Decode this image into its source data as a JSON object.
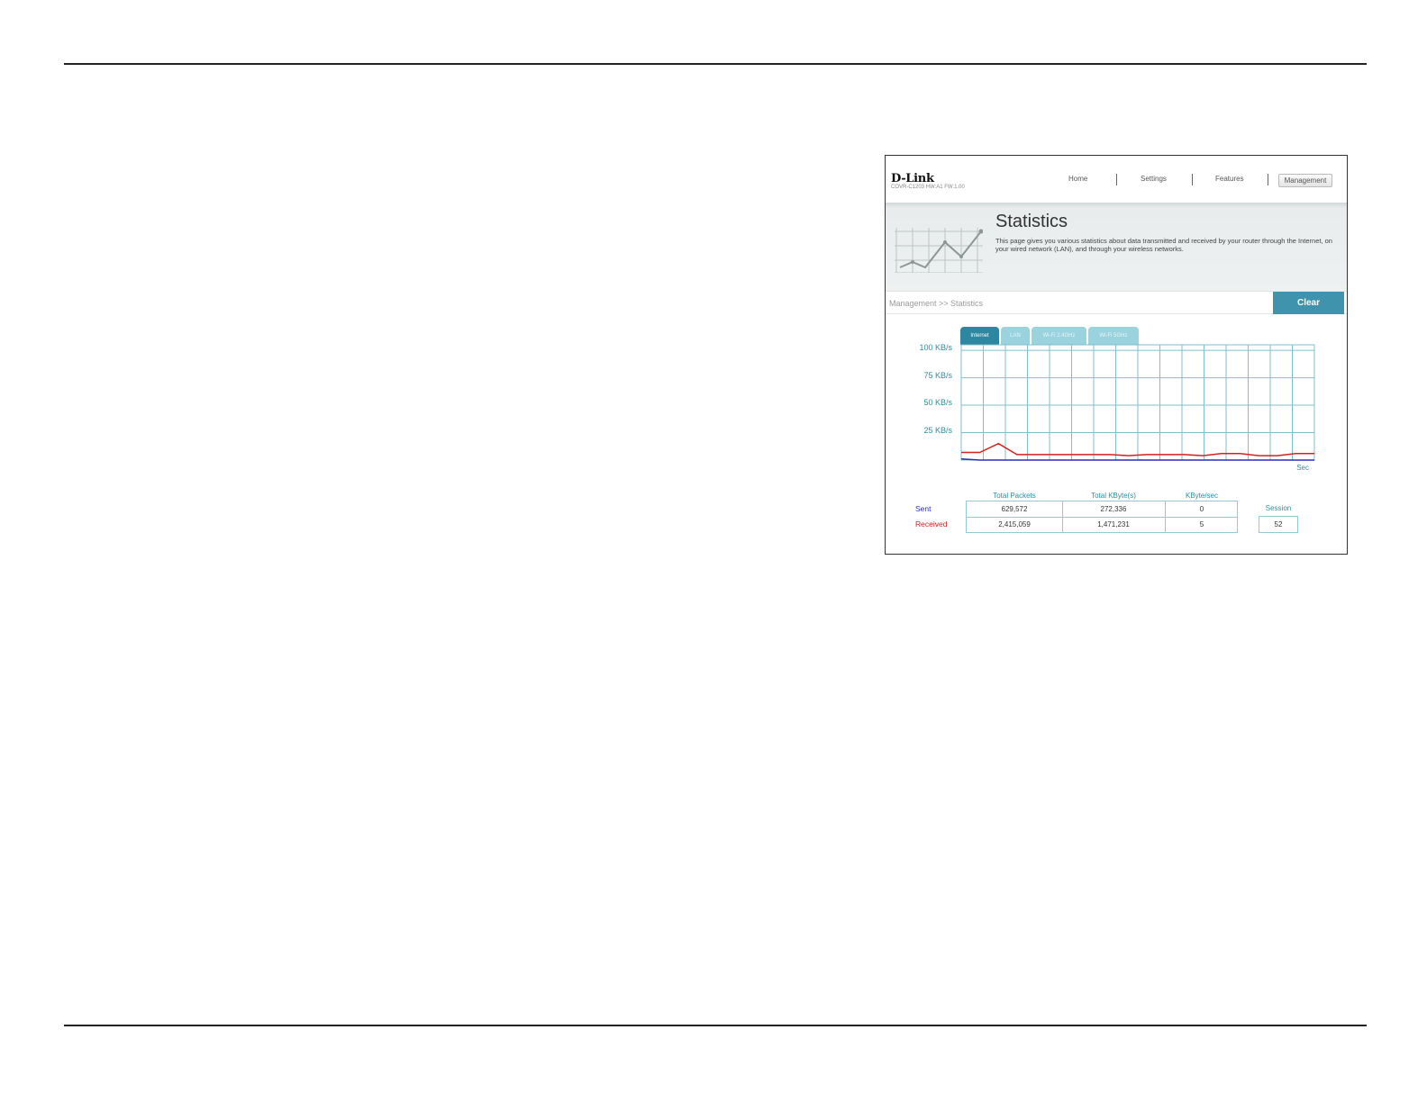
{
  "header": {
    "logo": "D-Link",
    "firmware": "COVR-C1203 HW:A1 FW:1.00",
    "nav": [
      "Home",
      "Settings",
      "Features",
      "Management"
    ],
    "active_nav": "Management"
  },
  "banner": {
    "title": "Statistics",
    "description": "This page gives you various statistics about data transmitted and received by your router through the Internet, on your wired network (LAN), and through your wireless networks."
  },
  "breadcrumb": "Management >> Statistics",
  "clear_label": "Clear",
  "tabs": [
    "Internet",
    "LAN",
    "Wi-Fi 2.4GHz",
    "Wi-Fi 5GHz"
  ],
  "active_tab": "Internet",
  "chart_data": {
    "type": "line",
    "y_ticks": [
      "100 KB/s",
      "75 KB/s",
      "50 KB/s",
      "25 KB/s"
    ],
    "ylim": [
      0,
      105
    ],
    "xlabel": "Sec",
    "grid": true,
    "series": [
      {
        "name": "Received",
        "color": "#d42020",
        "values": [
          7,
          7,
          15,
          5,
          5,
          5,
          5,
          5,
          5,
          4,
          5,
          5,
          5,
          4,
          6,
          6,
          4,
          4,
          6,
          6
        ]
      },
      {
        "name": "Sent",
        "color": "#2b2bbd",
        "values": [
          1,
          0,
          0,
          0,
          0,
          0,
          0,
          0,
          0,
          0,
          0,
          0,
          0,
          0,
          0,
          0,
          0,
          0,
          0,
          0
        ]
      }
    ]
  },
  "stats": {
    "headers": [
      "Total Packets",
      "Total KByte(s)",
      "KByte/sec"
    ],
    "rows": [
      {
        "label": "Sent",
        "color": "#2b2bbd",
        "values": [
          "629,572",
          "272,336",
          "0"
        ]
      },
      {
        "label": "Received",
        "color": "#d42020",
        "values": [
          "2,415,059",
          "1,471,231",
          "5"
        ]
      }
    ],
    "session_label": "Session",
    "session_value": "52"
  }
}
